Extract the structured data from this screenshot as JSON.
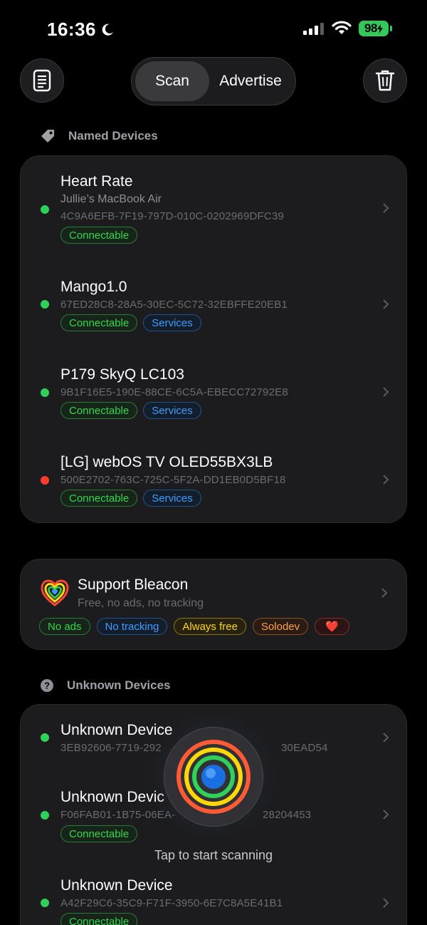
{
  "status_bar": {
    "time": "16:36",
    "battery": "98"
  },
  "top_bar": {
    "segments": [
      {
        "label": "Scan",
        "selected": true
      },
      {
        "label": "Advertise",
        "selected": false
      }
    ]
  },
  "sections": {
    "named": "Named Devices",
    "unknown": "Unknown Devices"
  },
  "named_devices": [
    {
      "name": "Heart Rate",
      "subtitle": "Jullie’s MacBook Air",
      "uuid": "4C9A6EFB-7F19-797D-010C-0202969DFC39",
      "status": "green",
      "tags": [
        "Connectable"
      ]
    },
    {
      "name": "Mango1.0",
      "uuid": "67ED28C8-28A5-30EC-5C72-32EBFFE20EB1",
      "status": "green",
      "tags": [
        "Connectable",
        "Services"
      ]
    },
    {
      "name": "P179 SkyQ LC103",
      "uuid": "9B1F16E5-190E-88CE-6C5A-EBECC72792E8",
      "status": "green",
      "tags": [
        "Connectable",
        "Services"
      ]
    },
    {
      "name": "[LG] webOS TV OLED55BX3LB",
      "uuid": "500E2702-763C-725C-5F2A-DD1EB0D5BF18",
      "status": "red",
      "tags": [
        "Connectable",
        "Services"
      ]
    }
  ],
  "support": {
    "title": "Support Bleacon",
    "subtitle": "Free, no ads, no tracking",
    "tags": [
      "No ads",
      "No tracking",
      "Always free",
      "Solodev",
      "❤️"
    ]
  },
  "unknown_devices": [
    {
      "name": "Unknown Device",
      "uuid_start": "3EB92606-7719-292",
      "uuid_end": "30EAD54",
      "status": "green",
      "tags": []
    },
    {
      "name": "Unknown Devic",
      "uuid_start": "F06FAB01-1B75-06EA-",
      "uuid_end": "28204453",
      "status": "green",
      "tags": [
        "Connectable"
      ]
    },
    {
      "name": "Unknown Device",
      "uuid": "A42F29C6-35C9-F71F-3950-6E7C8A5E41B1",
      "status": "green",
      "tags": [
        "Connectable"
      ]
    }
  ],
  "scan": {
    "label": "Tap to start scanning"
  },
  "colors": {
    "accent_green": "#30d158",
    "status_red": "#ff3b30",
    "card_bg": "#1c1c1e"
  }
}
